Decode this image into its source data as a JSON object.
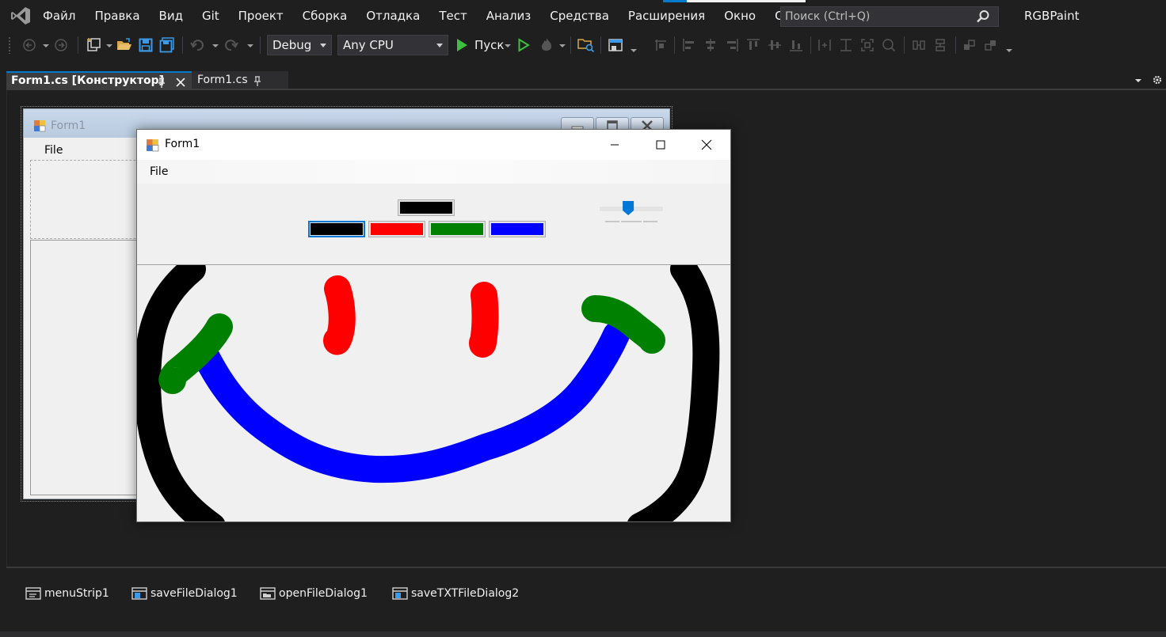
{
  "menubar": {
    "items": [
      "Файл",
      "Правка",
      "Вид",
      "Git",
      "Проект",
      "Сборка",
      "Отладка",
      "Тест",
      "Анализ",
      "Средства",
      "Расширения",
      "Окно",
      "Справка"
    ],
    "search_placeholder": "Поиск (Ctrl+Q)",
    "solution_name": "RGBPaint"
  },
  "toolbar": {
    "configuration": "Debug",
    "platform": "Any CPU",
    "start_label": "Пуск"
  },
  "tabs": {
    "active": "Form1.cs [Конструктор]",
    "inactive": "Form1.cs"
  },
  "designer_form": {
    "title": "Form1",
    "menu_file": "File"
  },
  "running_form": {
    "title": "Form1",
    "menu_file": "File",
    "current_color": "#000000",
    "palette": [
      {
        "name": "black",
        "color": "#000000"
      },
      {
        "name": "red",
        "color": "#ff0000"
      },
      {
        "name": "green",
        "color": "#008000"
      },
      {
        "name": "blue",
        "color": "#0000ff"
      }
    ],
    "trackbar_value_fraction": 0.45
  },
  "tray": {
    "components": [
      "menuStrip1",
      "saveFileDialog1",
      "openFileDialog1",
      "saveTXTFileDialog2"
    ]
  },
  "colors": {
    "ide_background": "#1f1f1f",
    "accent": "#007acc",
    "form_background": "#f0f0f0"
  }
}
